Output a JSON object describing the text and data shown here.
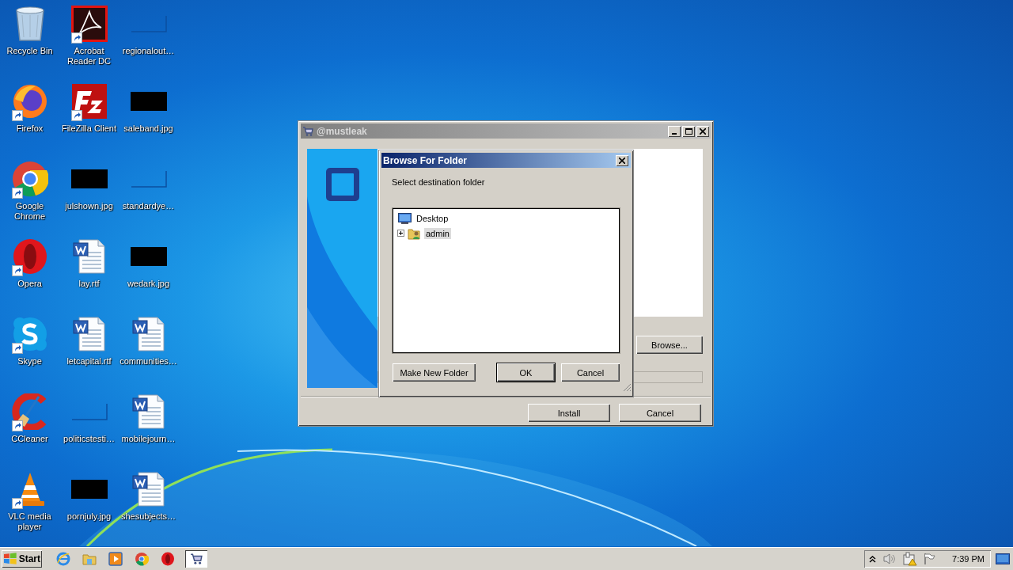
{
  "desktop_icons": [
    {
      "label": "Recycle Bin",
      "kind": "recycle",
      "shortcut": false
    },
    {
      "label": "Acrobat Reader DC",
      "kind": "acrobat",
      "shortcut": true
    },
    {
      "label": "regionalout…",
      "kind": "blank",
      "shortcut": false
    },
    {
      "label": "Firefox",
      "kind": "firefox",
      "shortcut": true
    },
    {
      "label": "FileZilla Client",
      "kind": "filezilla",
      "shortcut": true
    },
    {
      "label": "saleband.jpg",
      "kind": "image",
      "shortcut": false
    },
    {
      "label": "Google Chrome",
      "kind": "chrome",
      "shortcut": true
    },
    {
      "label": "julshown.jpg",
      "kind": "image",
      "shortcut": false
    },
    {
      "label": "standardye…",
      "kind": "blank",
      "shortcut": false
    },
    {
      "label": "Opera",
      "kind": "opera",
      "shortcut": true
    },
    {
      "label": "lay.rtf",
      "kind": "document",
      "shortcut": false
    },
    {
      "label": "wedark.jpg",
      "kind": "image",
      "shortcut": false
    },
    {
      "label": "Skype",
      "kind": "skype",
      "shortcut": true
    },
    {
      "label": "letcapital.rtf",
      "kind": "document",
      "shortcut": false
    },
    {
      "label": "communities…",
      "kind": "document",
      "shortcut": false
    },
    {
      "label": "CCleaner",
      "kind": "ccleaner",
      "shortcut": true
    },
    {
      "label": "politicstesti…",
      "kind": "blank",
      "shortcut": false
    },
    {
      "label": "mobilejourn…",
      "kind": "document",
      "shortcut": false
    },
    {
      "label": "VLC media player",
      "kind": "vlc",
      "shortcut": true
    },
    {
      "label": "pornjuly.jpg",
      "kind": "image",
      "shortcut": false
    },
    {
      "label": "shesubjects…",
      "kind": "document",
      "shortcut": false
    }
  ],
  "installer": {
    "title": "@mustleak",
    "browse_button": "Browse...",
    "buttons": [
      "Install",
      "Cancel"
    ]
  },
  "browse_dialog": {
    "title": "Browse For Folder",
    "prompt": "Select destination folder",
    "tree": [
      {
        "label": "Desktop",
        "selected": false,
        "children": [
          {
            "label": "admin",
            "selected": true,
            "expanded": false
          }
        ]
      }
    ],
    "buttons": [
      {
        "label": "Make New Folder",
        "default": false
      },
      {
        "label": "OK",
        "default": true
      },
      {
        "label": "Cancel",
        "default": false
      }
    ]
  },
  "taskbar": {
    "start": "Start",
    "apps": [
      {
        "kind": "ie",
        "selected": false
      },
      {
        "kind": "explorer",
        "selected": false
      },
      {
        "kind": "media",
        "selected": false
      },
      {
        "kind": "chrome",
        "selected": false
      },
      {
        "kind": "opera",
        "selected": false
      },
      {
        "kind": "installer",
        "selected": true
      }
    ],
    "clock": "7:39 PM"
  }
}
